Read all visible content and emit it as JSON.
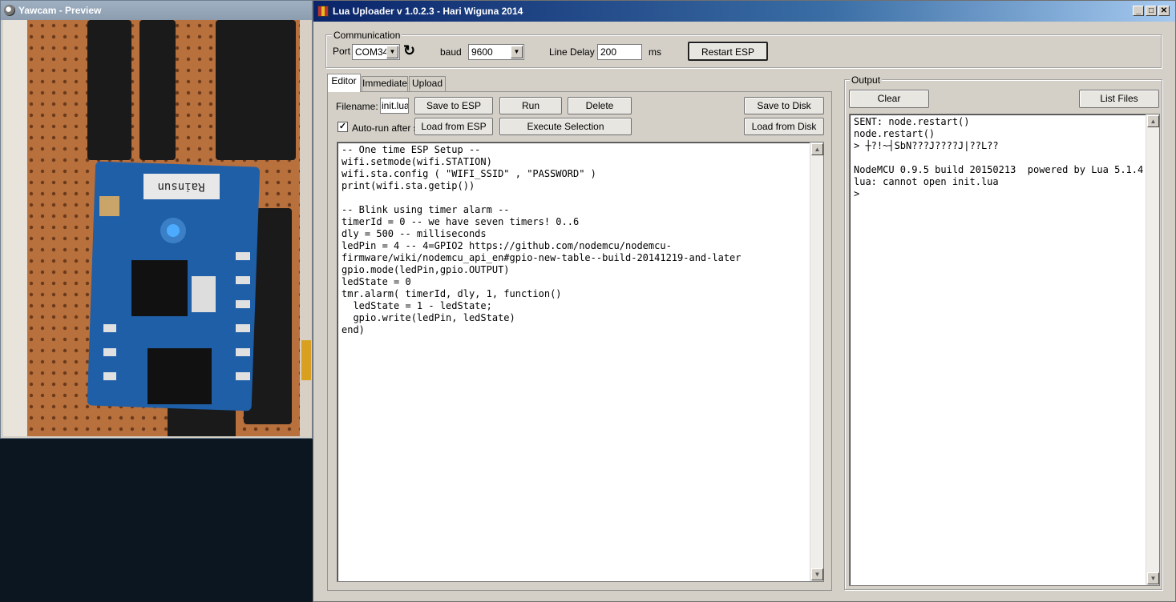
{
  "yawcam": {
    "title": "Yawcam - Preview",
    "board_label": "Rainsun"
  },
  "lua_window": {
    "title": "Lua Uploader v 1.0.2.3 - Hari Wiguna 2014",
    "controls": {
      "minimize": "_",
      "maximize": "□",
      "close": "✕"
    }
  },
  "communication": {
    "group_label": "Communication",
    "port_label": "Port",
    "port_value": "COM34",
    "baud_label": "baud",
    "baud_value": "9600",
    "line_delay_label": "Line Delay",
    "line_delay_value": "200",
    "line_delay_unit": "ms",
    "restart_button": "Restart ESP"
  },
  "tabs": [
    "Editor",
    "Immediate",
    "Upload"
  ],
  "editor": {
    "filename_label": "Filename:",
    "filename_value": "init.lua",
    "autorun_label": "Auto-run after sa",
    "autorun_checked": true,
    "buttons": {
      "save_to_esp": "Save to ESP",
      "run": "Run",
      "delete": "Delete",
      "save_to_disk": "Save to Disk",
      "load_from_esp": "Load from ESP",
      "execute_selection": "Execute Selection",
      "load_from_disk": "Load from Disk"
    },
    "code": "-- One time ESP Setup --\nwifi.setmode(wifi.STATION)\nwifi.sta.config ( \"WIFI_SSID\" , \"PASSWORD\" )\nprint(wifi.sta.getip())\n\n-- Blink using timer alarm --\ntimerId = 0 -- we have seven timers! 0..6\ndly = 500 -- milliseconds\nledPin = 4 -- 4=GPIO2 https://github.com/nodemcu/nodemcu-\nfirmware/wiki/nodemcu_api_en#gpio-new-table--build-20141219-and-later\ngpio.mode(ledPin,gpio.OUTPUT)\nledState = 0\ntmr.alarm( timerId, dly, 1, function()\n  ledState = 1 - ledState;\n  gpio.write(ledPin, ledState)\nend)"
  },
  "output": {
    "group_label": "Output",
    "clear_button": "Clear",
    "list_files_button": "List Files",
    "text": "SENT: node.restart()\nnode.restart()\n> ┼?!~┤SbN???J????J|??L??\n\nNodeMCU 0.9.5 build 20150213  powered by Lua 5.1.4\nlua: cannot open init.lua\n>"
  },
  "scroll": {
    "up": "▲",
    "down": "▼"
  },
  "icons": {
    "refresh": "↻",
    "check": "✓",
    "dropdown": "▼"
  }
}
